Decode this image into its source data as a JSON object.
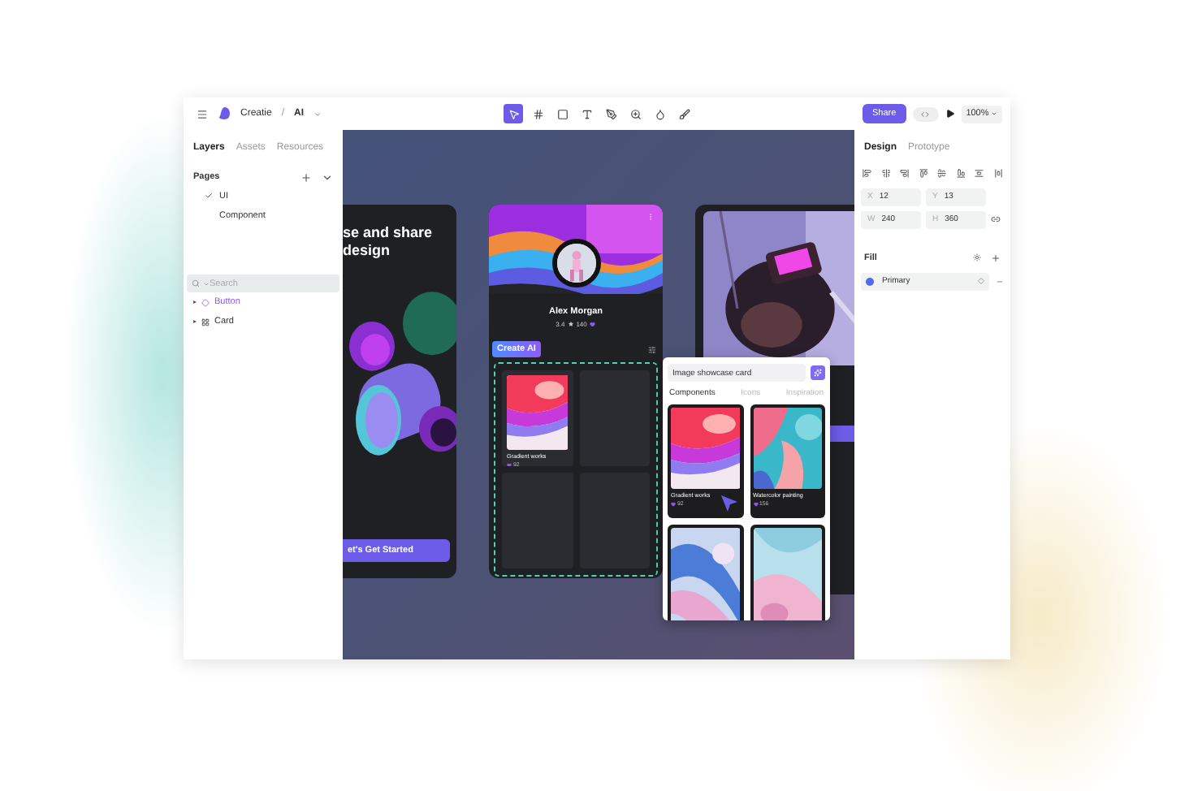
{
  "topbar": {
    "project": "Creatie",
    "separator": "/",
    "page": "AI",
    "tools": [
      {
        "kind": "move",
        "selected": true
      },
      {
        "kind": "frame",
        "selected": false
      },
      {
        "kind": "rect",
        "selected": false
      },
      {
        "kind": "text",
        "selected": false
      },
      {
        "kind": "pen",
        "selected": false
      },
      {
        "kind": "zoom",
        "selected": false
      },
      {
        "kind": "fill",
        "selected": false
      },
      {
        "kind": "brush",
        "selected": false
      }
    ],
    "share": "Share",
    "zoom": "100%"
  },
  "left_panel": {
    "tabs": [
      {
        "label": "Layers",
        "selected": true
      },
      {
        "label": "Assets",
        "selected": false
      },
      {
        "label": "Resources",
        "selected": false
      }
    ],
    "pages_title": "Pages",
    "pages": [
      {
        "label": "UI",
        "selected": true
      },
      {
        "label": "Component",
        "selected": false
      }
    ],
    "search": {
      "placeholder": "Search"
    },
    "layers": [
      {
        "label": "Button",
        "kind": "component"
      },
      {
        "label": "Card",
        "kind": "frame"
      }
    ]
  },
  "canvas": {
    "onboarding": {
      "title_lines": [
        "se and share",
        "design"
      ],
      "button": "et's Get Started"
    },
    "profile": {
      "name": "Alex Morgan",
      "rating": "3.4",
      "followers": "140",
      "tag": "Create AI",
      "tiles": [
        {
          "kind": "work",
          "title": "Gradient works",
          "count": "92"
        },
        {
          "kind": "empty"
        },
        {
          "kind": "empty"
        },
        {
          "kind": "empty"
        }
      ]
    },
    "popup": {
      "query": "Image showcase card",
      "tabs": [
        {
          "label": "Components",
          "selected": true
        },
        {
          "label": "Icons",
          "selected": false
        },
        {
          "label": "Inspiration",
          "selected": false
        }
      ],
      "items": [
        {
          "kind": "captioned",
          "title": "Gradient works",
          "count": "92"
        },
        {
          "kind": "captioned",
          "title": "Watercolor painting",
          "count": "156"
        },
        {
          "kind": "plain"
        },
        {
          "kind": "plain"
        }
      ]
    }
  },
  "right_panel": {
    "tabs": [
      {
        "label": "Design",
        "selected": true
      },
      {
        "label": "Prototype",
        "selected": false
      }
    ],
    "fields": [
      {
        "label": "X",
        "value": "12"
      },
      {
        "label": "Y",
        "value": "13"
      },
      {
        "label": "W",
        "value": "240"
      },
      {
        "label": "H",
        "value": "360"
      }
    ],
    "fill": {
      "title": "Fill",
      "items": [
        {
          "name": "Primary",
          "color": "#4f6bed"
        }
      ]
    }
  }
}
